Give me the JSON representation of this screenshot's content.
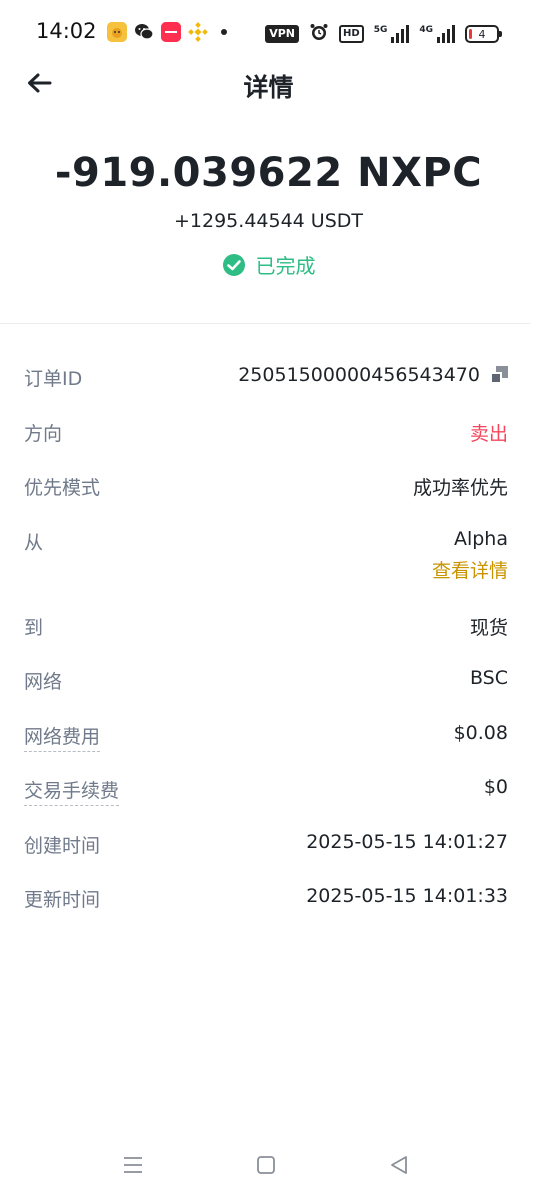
{
  "status_bar": {
    "time": "14:02",
    "app_icon_1": "斗地主",
    "app_icon_3": "小红书",
    "vpn": "VPN",
    "hd": "HD",
    "signal1_label": "5G",
    "signal2_label": "4G",
    "battery": "4"
  },
  "header": {
    "title": "详情"
  },
  "summary": {
    "amount": "-919.039622 NXPC",
    "received": "+1295.44544 USDT",
    "status": "已完成",
    "status_color": "#2ebd85"
  },
  "details": {
    "order_id": {
      "label": "订单ID",
      "value": "250515000004565434​70"
    },
    "direction": {
      "label": "方向",
      "value": "卖出"
    },
    "priority_mode": {
      "label": "优先模式",
      "value": "成功率优先"
    },
    "from": {
      "label": "从",
      "value": "Alpha",
      "link": "查看详情"
    },
    "to": {
      "label": "到",
      "value": "现货"
    },
    "network": {
      "label": "网络",
      "value": "BSC"
    },
    "network_fee": {
      "label": "网络费用",
      "value": "$0.08"
    },
    "trade_fee": {
      "label": "交易手续费",
      "value": "$0"
    },
    "created_time": {
      "label": "创建时间",
      "value": "2025-05-15 14:01:27"
    },
    "updated_time": {
      "label": "更新时间",
      "value": "2025-05-15 14:01:33"
    }
  },
  "colors": {
    "sell": "#f6465d",
    "link": "#c99400",
    "success": "#2ebd85"
  }
}
